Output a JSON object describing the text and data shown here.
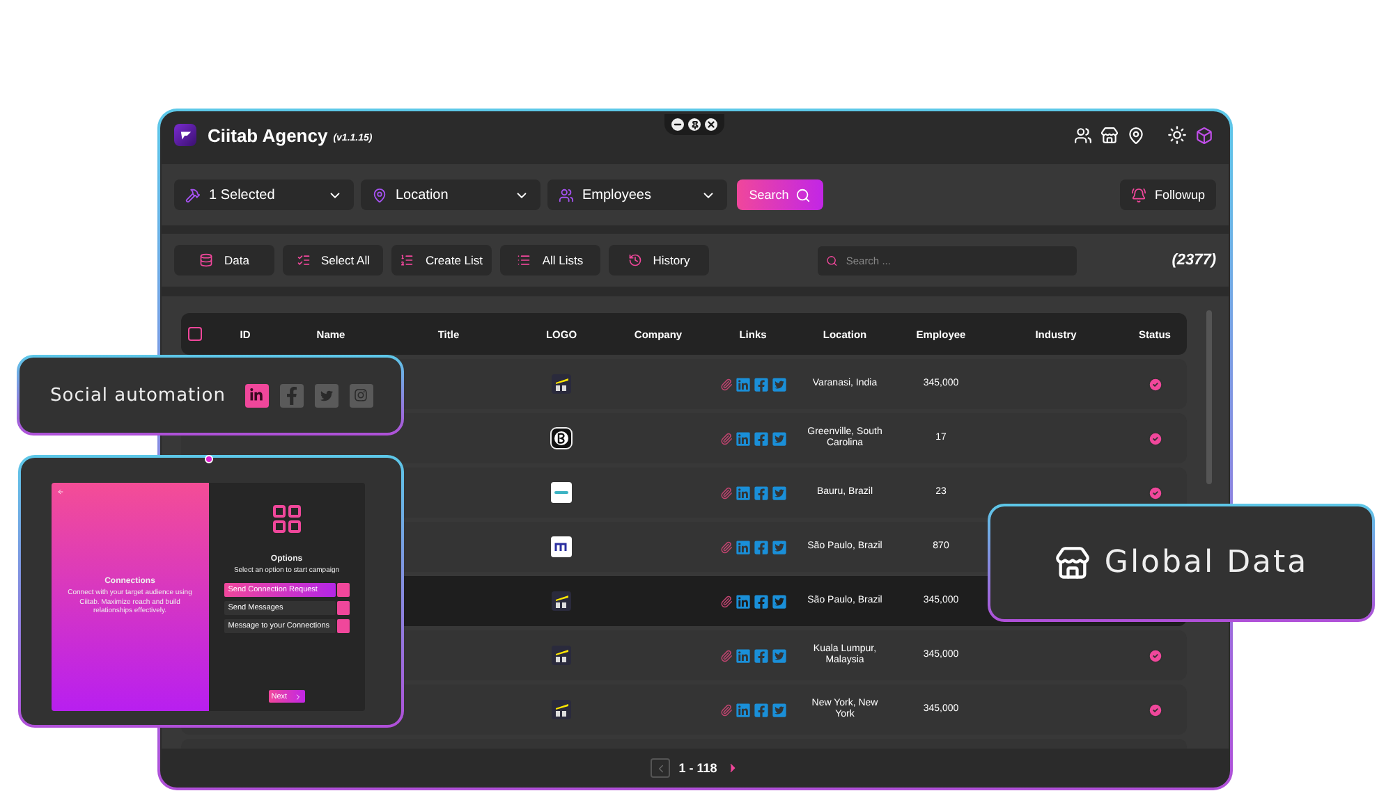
{
  "window": {
    "title": "Ciitab Agency",
    "version": "(v1.1.15)"
  },
  "filters": [
    {
      "kind": "industry",
      "label": "1 Selected"
    },
    {
      "kind": "location",
      "label": "Location"
    },
    {
      "kind": "employees",
      "label": "Employees"
    }
  ],
  "search_button": "Search",
  "followup_button": "Followup",
  "toolbar": [
    {
      "kind": "data",
      "label": "Data"
    },
    {
      "kind": "select",
      "label": "Select All"
    },
    {
      "kind": "create",
      "label": "Create List"
    },
    {
      "kind": "lists",
      "label": "All Lists"
    },
    {
      "kind": "history",
      "label": "History"
    }
  ],
  "search": {
    "placeholder": "Search ..."
  },
  "count": "(2377)",
  "table": {
    "select_all_checked": false,
    "columns": [
      "ID",
      "Name",
      "Title",
      "LOGO",
      "Company",
      "Links",
      "Location",
      "Employee",
      "Industry",
      "Status"
    ],
    "rows": [
      {
        "kind": "ey",
        "location": "Varanasi, India",
        "employee": "345,000",
        "verified": true,
        "selected": false
      },
      {
        "kind": "script",
        "location": "Greenville, South Carolina",
        "employee": "17",
        "verified": true,
        "selected": false
      },
      {
        "kind": "wide",
        "location": "Bauru, Brazil",
        "employee": "23",
        "verified": true,
        "selected": false
      },
      {
        "kind": "m",
        "location": "São Paulo, Brazil",
        "employee": "870",
        "selected": false
      },
      {
        "kind": "ey",
        "location": "São Paulo, Brazil",
        "employee": "345,000",
        "selected": true
      },
      {
        "kind": "ey",
        "location": "Kuala Lumpur, Malaysia",
        "employee": "345,000",
        "verified": true,
        "selected": false
      },
      {
        "kind": "ey",
        "location": "New York, New York",
        "employee": "345,000",
        "verified": true,
        "selected": false
      }
    ]
  },
  "pagination": {
    "range": "1 - 118",
    "prev_disabled": true
  },
  "social_card": {
    "title": "Social automation",
    "networks": [
      {
        "kind": "linkedin",
        "selected": true
      },
      {
        "kind": "facebook",
        "selected": false
      },
      {
        "kind": "twitter",
        "selected": false
      },
      {
        "kind": "instagram",
        "selected": false
      }
    ]
  },
  "tablet": {
    "title": "Connections",
    "text": "Connect with your target audience using Ciitab. Maximize reach and build relationships effectively.",
    "options_title": "Options",
    "options_subtitle": "Select an option to start campaign",
    "options": [
      {
        "label": "Send Connection Request",
        "selected": true
      },
      {
        "label": "Send Messages",
        "selected": false
      },
      {
        "label": "Message to your Connections",
        "selected": false
      }
    ],
    "next": "Next"
  },
  "global_card": {
    "title": "Global Data"
  }
}
